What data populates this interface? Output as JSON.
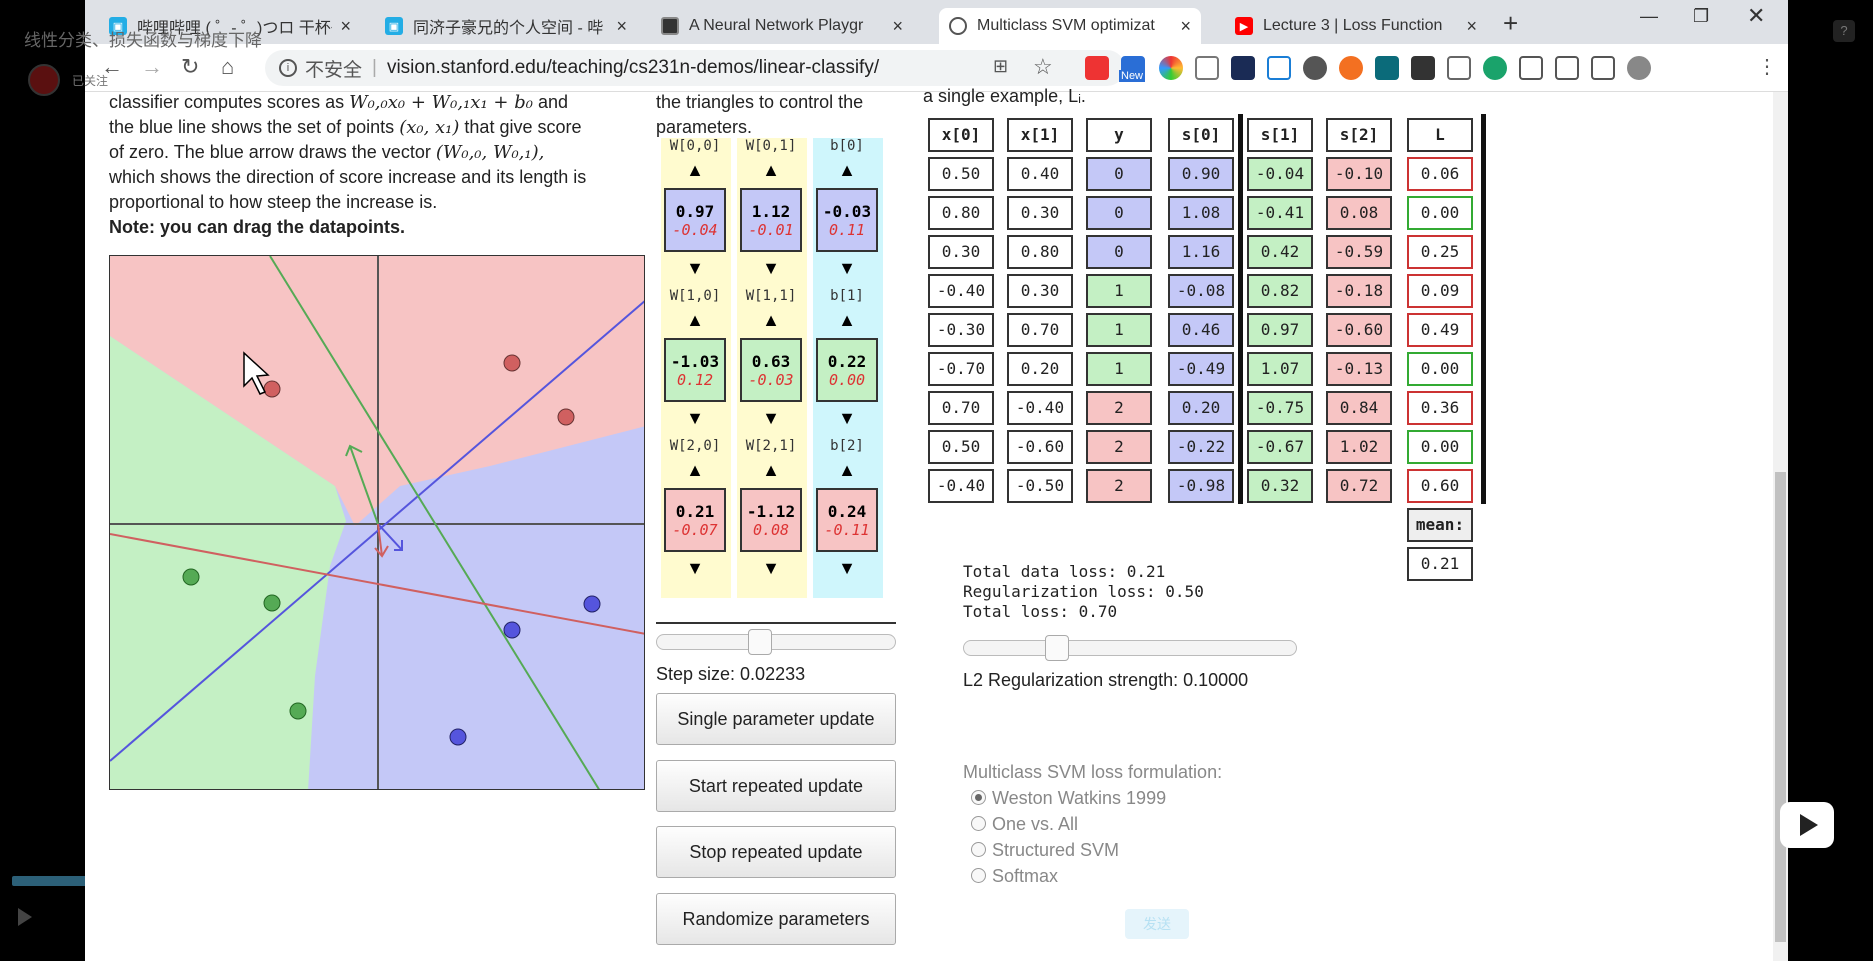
{
  "overlay": {
    "title": "线性分类、损失函数与梯度下降",
    "follow": "已关注",
    "help": "?"
  },
  "tabs": [
    {
      "label": "哔哩哔哩 ( ゜- ゜)つロ 干杯~",
      "close": "×"
    },
    {
      "label": "同济子豪兄的个人空间 - 哔",
      "close": "×"
    },
    {
      "label": "A Neural Network Playgr",
      "close": "×"
    },
    {
      "label": "Multiclass SVM optimizat",
      "close": "×"
    },
    {
      "label": "Lecture 3 | Loss Function",
      "close": "×"
    }
  ],
  "toolbar": {
    "insecure": "不安全",
    "url": "vision.stanford.edu/teaching/cs231n-demos/linear-classify/",
    "new_badge": "New"
  },
  "description": {
    "line1a": "classifier computes scores as ",
    "m1": "W₀,₀x₀ + W₀,₁x₁ + b₀",
    "line1b": " and",
    "line2a": "the blue line shows the set of points ",
    "m2": "(x₀, x₁)",
    "line2b": " that give score",
    "line3a": "of zero. The blue arrow draws the vector ",
    "m3": "(W₀,₀, W₀,₁),",
    "line4": "which shows the direction of score increase and its length is",
    "line5": "proportional to how steep the increase is.",
    "note": "Note: you can drag the datapoints."
  },
  "controls_intro": {
    "line1": "the triangles to control the",
    "line2": "parameters."
  },
  "params": [
    {
      "label": "W[0,0]",
      "value": "0.97",
      "grad": "-0.04",
      "color": "#c4c8f7"
    },
    {
      "label": "W[0,1]",
      "value": "1.12",
      "grad": "-0.01",
      "color": "#c4c8f7"
    },
    {
      "label": "b[0]",
      "value": "-0.03",
      "grad": "0.11",
      "color": "#c4c8f7"
    },
    {
      "label": "W[1,0]",
      "value": "-1.03",
      "grad": "0.12",
      "color": "#c4f0c4"
    },
    {
      "label": "W[1,1]",
      "value": "0.63",
      "grad": "-0.03",
      "color": "#c4f0c4"
    },
    {
      "label": "b[1]",
      "value": "0.22",
      "grad": "0.00",
      "color": "#c4f0c4"
    },
    {
      "label": "W[2,0]",
      "value": "0.21",
      "grad": "-0.07",
      "color": "#f7c4c4"
    },
    {
      "label": "W[2,1]",
      "value": "-1.12",
      "grad": "0.08",
      "color": "#f7c4c4"
    },
    {
      "label": "b[2]",
      "value": "0.24",
      "grad": "-0.11",
      "color": "#f7c4c4"
    }
  ],
  "triangles": {
    "up": "▲",
    "down": "▼"
  },
  "step": {
    "label": "Step size: 0.02233",
    "level": 0.42
  },
  "buttons": {
    "single": "Single parameter update",
    "start": "Start repeated update",
    "stop": "Stop repeated update",
    "randomize": "Randomize parameters"
  },
  "loss_header": "a single example, Lᵢ.",
  "table": {
    "headers": [
      "x[0]",
      "x[1]",
      "y",
      "s[0]",
      "s[1]",
      "s[2]",
      "L"
    ],
    "rows": [
      [
        "0.50",
        "0.40",
        "0",
        "0.90",
        "-0.04",
        "-0.10",
        "0.06"
      ],
      [
        "0.80",
        "0.30",
        "0",
        "1.08",
        "-0.41",
        "0.08",
        "0.00"
      ],
      [
        "0.30",
        "0.80",
        "0",
        "1.16",
        "0.42",
        "-0.59",
        "0.25"
      ],
      [
        "-0.40",
        "0.30",
        "1",
        "-0.08",
        "0.82",
        "-0.18",
        "0.09"
      ],
      [
        "-0.30",
        "0.70",
        "1",
        "0.46",
        "0.97",
        "-0.60",
        "0.49"
      ],
      [
        "-0.70",
        "0.20",
        "1",
        "-0.49",
        "1.07",
        "-0.13",
        "0.00"
      ],
      [
        "0.70",
        "-0.40",
        "2",
        "0.20",
        "-0.75",
        "0.84",
        "0.36"
      ],
      [
        "0.50",
        "-0.60",
        "2",
        "-0.22",
        "-0.67",
        "1.02",
        "0.00"
      ],
      [
        "-0.40",
        "-0.50",
        "2",
        "-0.98",
        "0.32",
        "0.72",
        "0.60"
      ]
    ],
    "mean_label": "mean:",
    "mean_value": "0.21"
  },
  "loss": {
    "data": "Total data loss: 0.21",
    "reg": "Regularization loss: 0.50",
    "total": "Total loss: 0.70"
  },
  "reg_slider": {
    "label": "L2 Regularization strength: 0.10000",
    "level": 0.26
  },
  "formulation": {
    "title": "Multiclass SVM loss formulation:",
    "options": [
      "Weston Watkins 1999",
      "One vs. All",
      "Structured SVM",
      "Softmax"
    ],
    "selected": 0
  },
  "send_label": "发送",
  "colors": {
    "class0": "#c4c8f7",
    "class1": "#c4f0c4",
    "class2": "#f7c4c4",
    "grad": "#d33"
  }
}
